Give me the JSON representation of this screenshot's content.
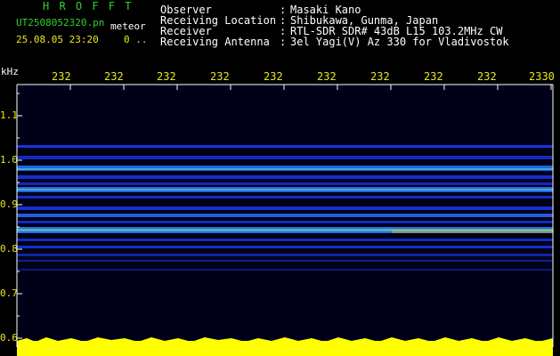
{
  "app": {
    "title_letters": "H R O F F T",
    "filename": "UT2508052320.pn",
    "meteor_label": "meteor",
    "datetime": "25.08.05 23:20",
    "count": "0 .."
  },
  "header": {
    "rows": [
      {
        "label": "Observer",
        "value": "Masaki Kano"
      },
      {
        "label": "Receiving Location",
        "value": "Shibukawa, Gunma, Japan"
      },
      {
        "label": "Receiver",
        "value": "RTL-SDR SDR# 43dB L15 103.2MHz CW"
      },
      {
        "label": "Receiving Antenna",
        "value": "3el Yagi(V) Az 330 for Vladivostok"
      }
    ]
  },
  "axes": {
    "y_unit": "kHz",
    "y_ticks": [
      "1.1",
      "1.0",
      "0.9",
      "0.8",
      "0.7",
      "0.6"
    ],
    "x_ticks": [
      "232",
      "232",
      "232",
      "232",
      "232",
      "232",
      "232",
      "232",
      "232",
      "2330"
    ]
  },
  "colors": {
    "axis_label": "#e8e820",
    "title_green": "#2fd12f",
    "signal_band": "#ffff00",
    "background": "#000000"
  }
}
